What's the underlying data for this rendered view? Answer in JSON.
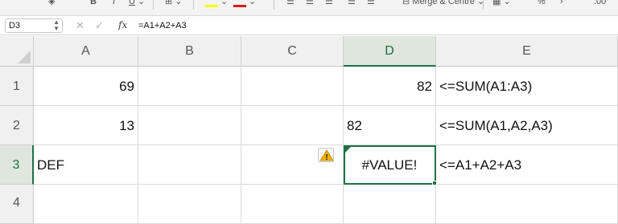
{
  "toolbar": {
    "merge_label": "Merge & Centre",
    "percent_label": "%",
    "decimal_label": ".00"
  },
  "formula_bar": {
    "cell_reference": "D3",
    "formula": "=A1+A2+A3",
    "fx_label": "fx",
    "cancel_glyph": "✕",
    "enter_glyph": "✓"
  },
  "sheet": {
    "columns": [
      "A",
      "B",
      "C",
      "D",
      "E"
    ],
    "rows": [
      "1",
      "2",
      "3",
      "4"
    ],
    "selected_column": "D",
    "selected_row": "3",
    "cells": {
      "A1": "69",
      "D1": "82",
      "E1": "<=SUM(A1:A3)",
      "A2": "13",
      "D2": "82",
      "E2": "<=SUM(A1,A2,A3)",
      "A3": "DEF",
      "D3": "#VALUE!",
      "E3": "<=A1+A2+A3"
    },
    "error_indicator": {
      "icon": "warning-icon",
      "glyph": "!",
      "color": "#f2b100"
    }
  },
  "colors": {
    "accent_green": "#1e7145",
    "fill_yellow": "#ffff00",
    "font_red": "#e0161a"
  }
}
